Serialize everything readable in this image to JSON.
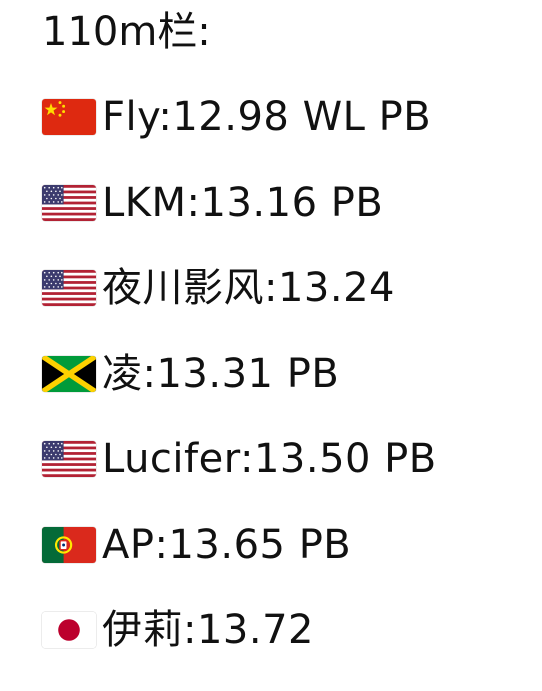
{
  "title": "110m栏:",
  "results": [
    {
      "flag": "china-flag-icon",
      "text": "Fly:12.98 WL PB"
    },
    {
      "flag": "usa-flag-icon",
      "text": "LKM:13.16 PB"
    },
    {
      "flag": "usa-flag-icon",
      "text": "夜川影风:13.24"
    },
    {
      "flag": "jamaica-flag-icon",
      "text": "凌:13.31 PB"
    },
    {
      "flag": "usa-flag-icon",
      "text": "Lucifer:13.50 PB"
    },
    {
      "flag": "portugal-flag-icon",
      "text": "AP:13.65 PB"
    },
    {
      "flag": "japan-flag-icon",
      "text": "伊莉:13.72"
    }
  ]
}
